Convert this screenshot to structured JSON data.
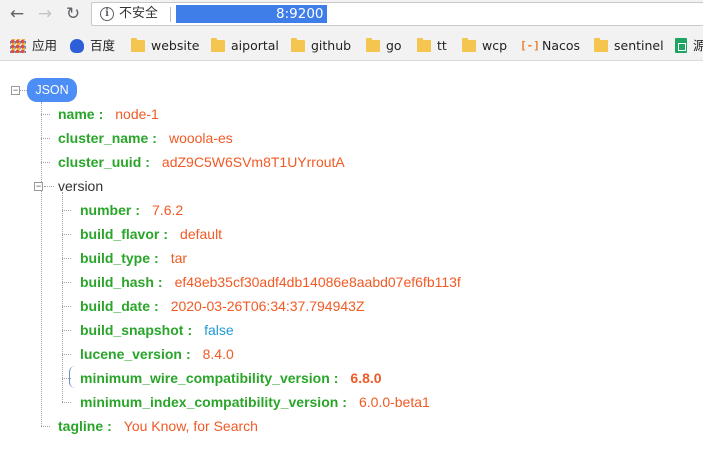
{
  "toolbar": {
    "back_icon": "arrow-left-icon",
    "forward_icon": "arrow-right-icon",
    "reload_icon": "reload-icon",
    "security_label": "不安全",
    "url": "8:9200"
  },
  "bookmarks": [
    {
      "label": "应用",
      "icon": "apps-grid-icon"
    },
    {
      "label": "百度",
      "icon": "baidu-paw-icon"
    },
    {
      "label": "website",
      "icon": "folder-icon"
    },
    {
      "label": "aiportal",
      "icon": "folder-icon"
    },
    {
      "label": "github",
      "icon": "folder-icon"
    },
    {
      "label": "go",
      "icon": "folder-icon"
    },
    {
      "label": "tt",
      "icon": "folder-icon"
    },
    {
      "label": "wcp",
      "icon": "folder-icon"
    },
    {
      "label": "Nacos",
      "icon": "nacos-logo-icon",
      "logo_text": "[-]"
    },
    {
      "label": "sentinel",
      "icon": "folder-icon"
    },
    {
      "label": "源",
      "icon": "sheets-icon"
    }
  ],
  "json_viewer": {
    "root_label": "JSON",
    "colors": {
      "key": "#2aa52a",
      "string": "#f15a24",
      "boolean": "#1e9ad6",
      "badge": "#4c8df6"
    },
    "name": {
      "key": "name",
      "value": "node-1"
    },
    "cluster_name": {
      "key": "cluster_name",
      "value": "wooola-es"
    },
    "cluster_uuid": {
      "key": "cluster_uuid",
      "value": "adZ9C5W6SVm8T1UYrroutA"
    },
    "version": {
      "key": "version",
      "number": {
        "key": "number",
        "value": "7.6.2"
      },
      "build_flavor": {
        "key": "build_flavor",
        "value": "default"
      },
      "build_type": {
        "key": "build_type",
        "value": "tar"
      },
      "build_hash": {
        "key": "build_hash",
        "value": "ef48eb35cf30adf4db14086e8aabd07ef6fb113f"
      },
      "build_date": {
        "key": "build_date",
        "value": "2020-03-26T06:34:37.794943Z"
      },
      "build_snapshot": {
        "key": "build_snapshot",
        "value": "false"
      },
      "lucene_version": {
        "key": "lucene_version",
        "value": "8.4.0"
      },
      "minimum_wire_compatibility_version": {
        "key": "minimum_wire_compatibility_version",
        "value": "6.8.0"
      },
      "minimum_index_compatibility_version": {
        "key": "minimum_index_compatibility_version",
        "value": "6.0.0-beta1"
      }
    },
    "tagline": {
      "key": "tagline",
      "value": "You Know, for Search"
    },
    "colon": ":",
    "collapse_symbol": "−"
  }
}
